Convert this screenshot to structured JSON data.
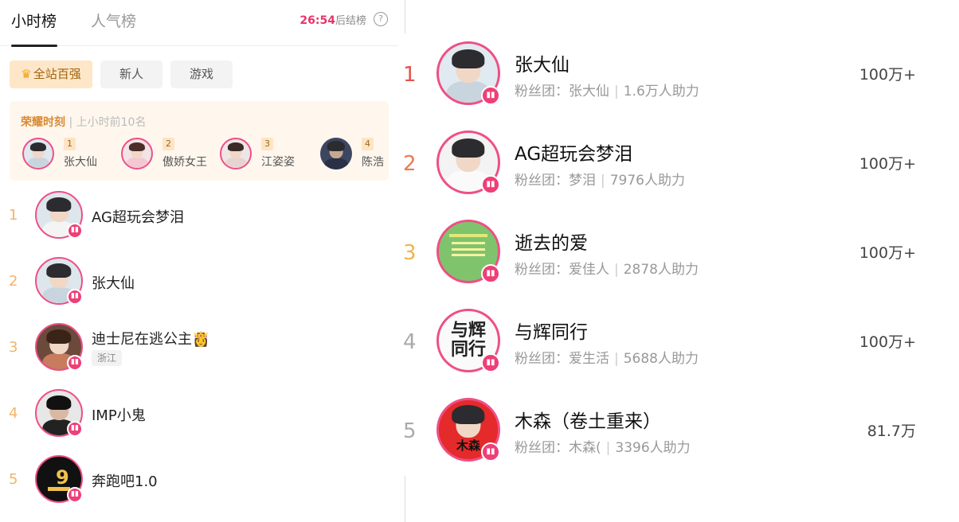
{
  "tabs": {
    "hourly": "小时榜",
    "popularity": "人气榜"
  },
  "countdown": {
    "time": "26:54",
    "suffix": "后结榜"
  },
  "help_symbol": "?",
  "filters": {
    "top100": "全站百强",
    "newcomer": "新人",
    "game": "游戏"
  },
  "glory": {
    "title": "荣耀时刻",
    "subtitle": "上小时前10名",
    "items": [
      {
        "rank": "1",
        "name": "张大仙"
      },
      {
        "rank": "2",
        "name": "傲娇女王"
      },
      {
        "rank": "3",
        "name": "江姿姿"
      },
      {
        "rank": "4",
        "name": "陈浩"
      }
    ]
  },
  "left_list": [
    {
      "rank": "1",
      "name": "AG超玩会梦泪",
      "tag": ""
    },
    {
      "rank": "2",
      "name": "张大仙",
      "tag": ""
    },
    {
      "rank": "3",
      "name": "迪士尼在逃公主👸",
      "tag": "浙江"
    },
    {
      "rank": "4",
      "name": "IMP小鬼",
      "tag": ""
    },
    {
      "rank": "5",
      "name": "奔跑吧1.0",
      "tag": ""
    }
  ],
  "right_list": [
    {
      "rank": "1",
      "name": "张大仙",
      "fan_label": "粉丝团：张大仙",
      "assist": "1.6万人助力",
      "score": "100万+"
    },
    {
      "rank": "2",
      "name": "AG超玩会梦泪",
      "fan_label": "粉丝团：梦泪",
      "assist": "7976人助力",
      "score": "100万+"
    },
    {
      "rank": "3",
      "name": "逝去的爱",
      "fan_label": "粉丝团：爱佳人",
      "assist": "2878人助力",
      "score": "100万+"
    },
    {
      "rank": "4",
      "name": "与辉同行",
      "fan_label": "粉丝团：爱生活",
      "assist": "5688人助力",
      "score": "100万+"
    },
    {
      "rank": "5",
      "name": "木森（卷土重来）",
      "fan_label": "粉丝团：木森(",
      "assist": "3396人助力",
      "score": "81.7万"
    }
  ],
  "avatar_text": {
    "yu_hui": "与辉同行",
    "mu_sen": "木森"
  },
  "badge_icon": "live-bars-icon",
  "colors": {
    "accent_pink": "#ee3f76",
    "countdown_red": "#e8356b",
    "rank1": "#e5534b",
    "rank2": "#ec7a52",
    "rank3": "#f2b54a",
    "rank_other": "#aaaaaa"
  }
}
